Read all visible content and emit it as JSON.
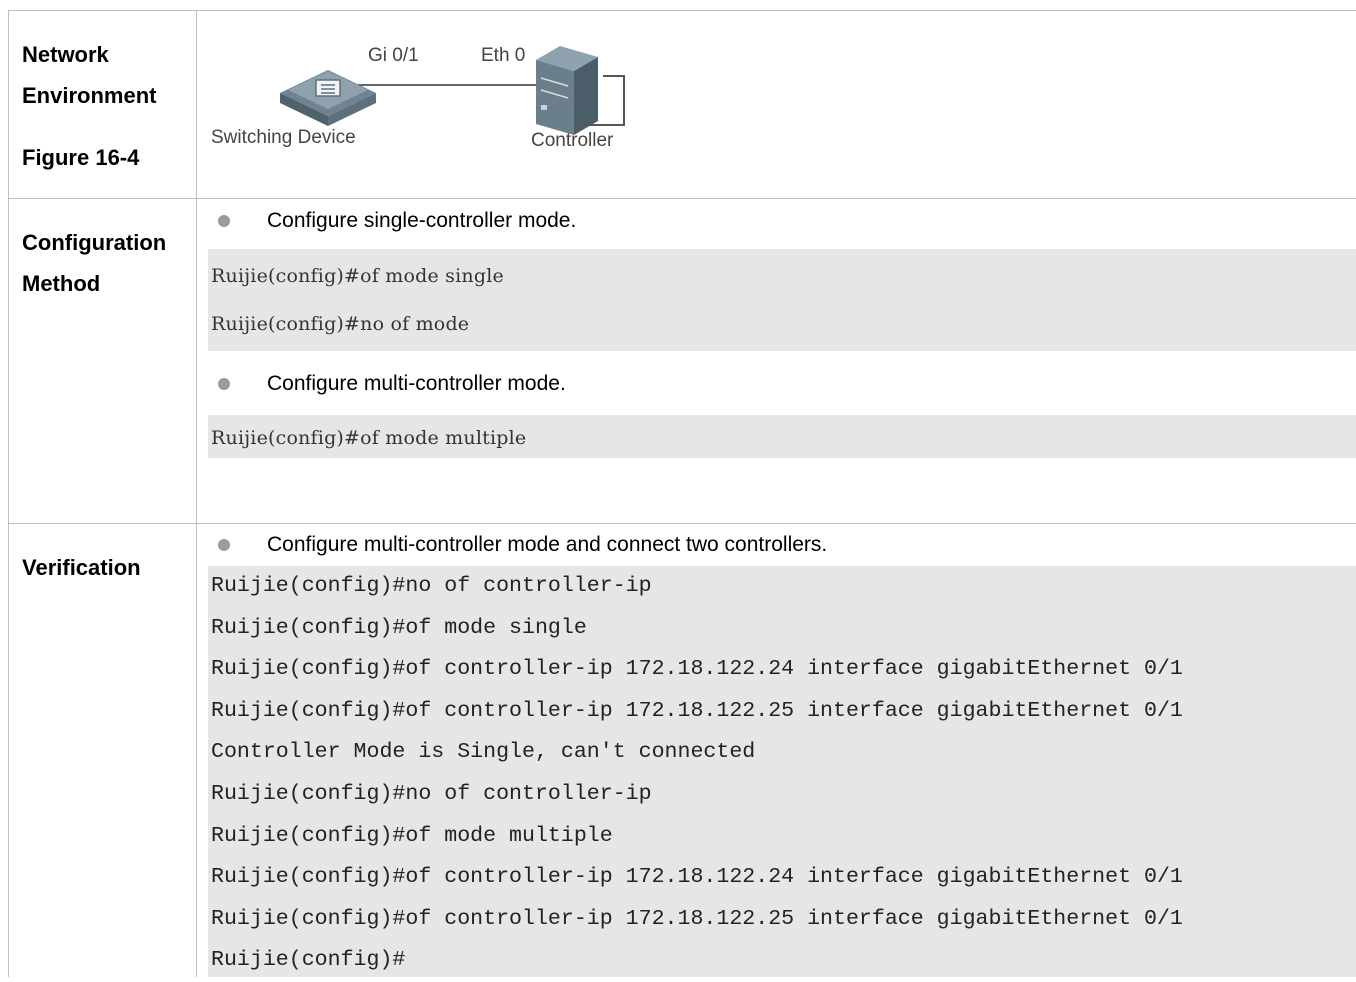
{
  "rows": {
    "network": {
      "labels": [
        "Network",
        "Environment",
        "Figure 16-4"
      ],
      "diagram": {
        "switch_label": "Switching Device",
        "controller_label": "Controller",
        "port_switch": "Gi 0/1",
        "port_controller": "Eth 0"
      }
    },
    "config": {
      "labels": [
        "Configuration",
        "Method"
      ],
      "bullet1": "Configure single-controller mode.",
      "code1": [
        "Ruijie(config)#of mode single",
        "Ruijie(config)#no of mode"
      ],
      "bullet2": "Configure multi-controller mode.",
      "code2": [
        "Ruijie(config)#of mode multiple"
      ]
    },
    "verify": {
      "label": "Verification",
      "bullet": "Configure multi-controller mode and connect two controllers.",
      "code": [
        "Ruijie(config)#no of controller-ip",
        "Ruijie(config)#of mode single",
        "Ruijie(config)#of controller-ip 172.18.122.24 interface gigabitEthernet 0/1",
        "Ruijie(config)#of controller-ip 172.18.122.25 interface gigabitEthernet 0/1",
        "Controller Mode is Single, can't connected",
        "Ruijie(config)#no of controller-ip",
        "Ruijie(config)#of mode multiple",
        "Ruijie(config)#of controller-ip 172.18.122.24 interface gigabitEthernet 0/1",
        "Ruijie(config)#of controller-ip 172.18.122.25 interface gigabitEthernet 0/1",
        "Ruijie(config)#"
      ]
    }
  }
}
